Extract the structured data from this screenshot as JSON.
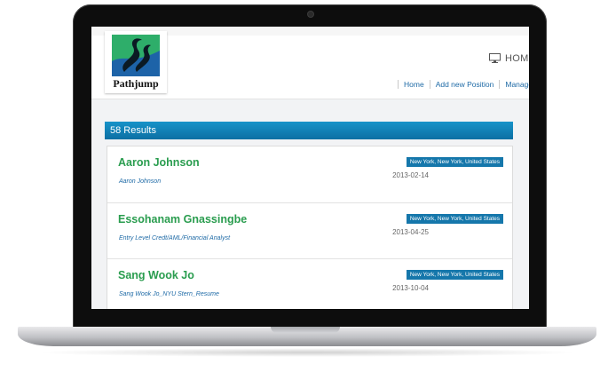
{
  "brand": {
    "name": "Pathjump"
  },
  "top_nav": {
    "home_label": "HOME",
    "icon": "monitor-icon"
  },
  "nav": {
    "items": [
      "Home",
      "Add new Position",
      "Manage"
    ]
  },
  "results": {
    "heading": "58 Results"
  },
  "candidates": [
    {
      "name": "Aaron Johnson",
      "subtitle": "Aaron Johnson",
      "location": "New York, New York, United States",
      "date": "2013-02-14"
    },
    {
      "name": "Essohanam Gnassingbe",
      "subtitle": "Entry Level Credt/AML/Financial Analyst",
      "location": "New York, New York, United States",
      "date": "2013-04-25"
    },
    {
      "name": "Sang Wook Jo",
      "subtitle": "Sang Wook Jo_NYU Stern_Resume",
      "location": "New York, New York, United States",
      "date": "2013-10-04"
    }
  ],
  "colors": {
    "accent": "#1577ab",
    "name_green": "#2a9d4f",
    "link_blue": "#1e6aa6"
  }
}
